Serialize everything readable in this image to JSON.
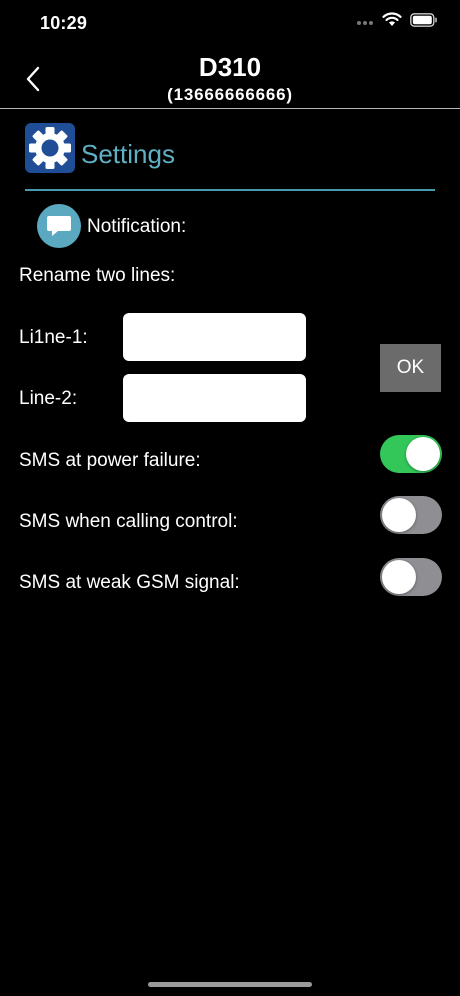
{
  "status_bar": {
    "time": "10:29"
  },
  "nav": {
    "title": "D310",
    "subtitle": "(13666666666)"
  },
  "settings": {
    "title": "Settings"
  },
  "notification": {
    "label": "Notification:"
  },
  "rename": {
    "label": "Rename two lines:",
    "line1_label": "Li1ne-1:",
    "line1_value": "",
    "line2_label": "Line-2:",
    "line2_value": "",
    "ok_label": "OK"
  },
  "sms_options": [
    {
      "label": "SMS at power failure:",
      "enabled": true
    },
    {
      "label": "SMS when calling control:",
      "enabled": false
    },
    {
      "label": "SMS at weak GSM signal:",
      "enabled": false
    }
  ],
  "colors": {
    "toggle_on": "#33c759",
    "toggle_off": "#8e8e93",
    "accent": "#5fb0c4",
    "settings_icon_bg": "#1f4e96"
  }
}
